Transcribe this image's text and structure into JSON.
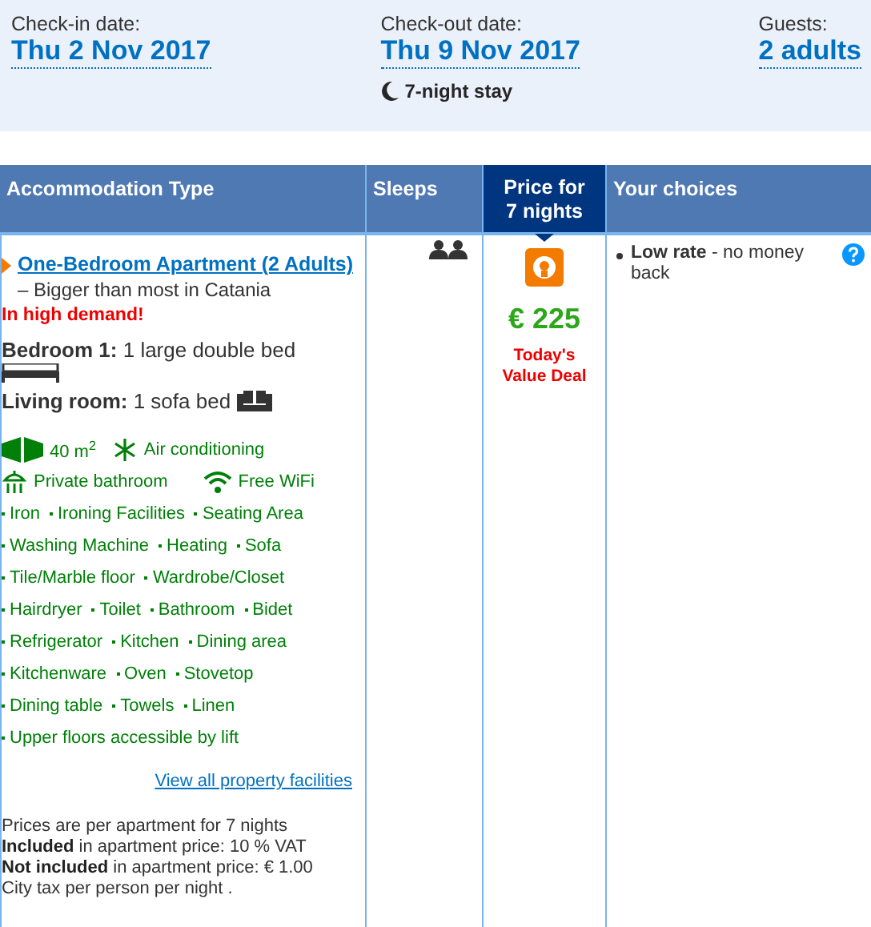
{
  "stay": {
    "checkin": {
      "label": "Check-in date:",
      "value": "Thu 2 Nov 2017"
    },
    "checkout": {
      "label": "Check-out date:",
      "value": "Thu 9 Nov 2017",
      "nights": "7-night stay"
    },
    "guests": {
      "label": "Guests:",
      "value": "2 adults"
    }
  },
  "columns": [
    {
      "label": "Accommodation Type",
      "highlighted": false
    },
    {
      "label": "Sleeps",
      "highlighted": false
    },
    {
      "label": "Price for 7 nights",
      "highlighted": true
    },
    {
      "label": "Your choices",
      "highlighted": false
    }
  ],
  "room": {
    "name": "One-Bedroom Apartment (2 Adults)",
    "description": " – Bigger than most in Catania",
    "demand": "In high demand!",
    "beds": [
      {
        "kind": "bed",
        "label": "Bedroom 1:",
        "value": " 1 large double bed"
      },
      {
        "kind": "sofa",
        "label": "Living room:",
        "value": " 1 sofa bed"
      }
    ],
    "highlights": [
      [
        {
          "kind": "size",
          "text": "40 m$^{2}$"
        },
        {
          "kind": "snowflake",
          "text": "Air conditioning"
        }
      ],
      [
        {
          "kind": "shower",
          "text": "Private bathroom"
        },
        {
          "kind": "wifi",
          "text": "Free WiFi"
        }
      ]
    ],
    "facilities": [
      [
        "Iron",
        "Ironing Facilities",
        "Seating Area"
      ],
      [
        "Washing Machine",
        "Heating",
        "Sofa"
      ],
      [
        "Tile/Marble floor",
        "Wardrobe/Closet"
      ],
      [
        "Hairdryer",
        "Toilet",
        "Bathroom",
        "Bidet"
      ],
      [
        "Refrigerator",
        "Kitchen",
        "Dining area"
      ],
      [
        "Kitchenware",
        "Oven",
        "Stovetop"
      ],
      [
        "Dining table",
        "Towels",
        "Linen"
      ],
      [
        "Upper floors accessible by lift"
      ]
    ],
    "facilities_link": "View all property facilities",
    "notes": [
      "Prices are per apartment for 7 nights",
      "**Included** in apartment price: 10 % VAT",
      "**Not included** in apartment price: € 1.00",
      "City tax per person per night ."
    ]
  },
  "price": {
    "amount": "€ 225",
    "deal": "Today's Value Deal"
  },
  "choices": [
    {
      "text": "**Low rate** - no money back"
    }
  ]
}
